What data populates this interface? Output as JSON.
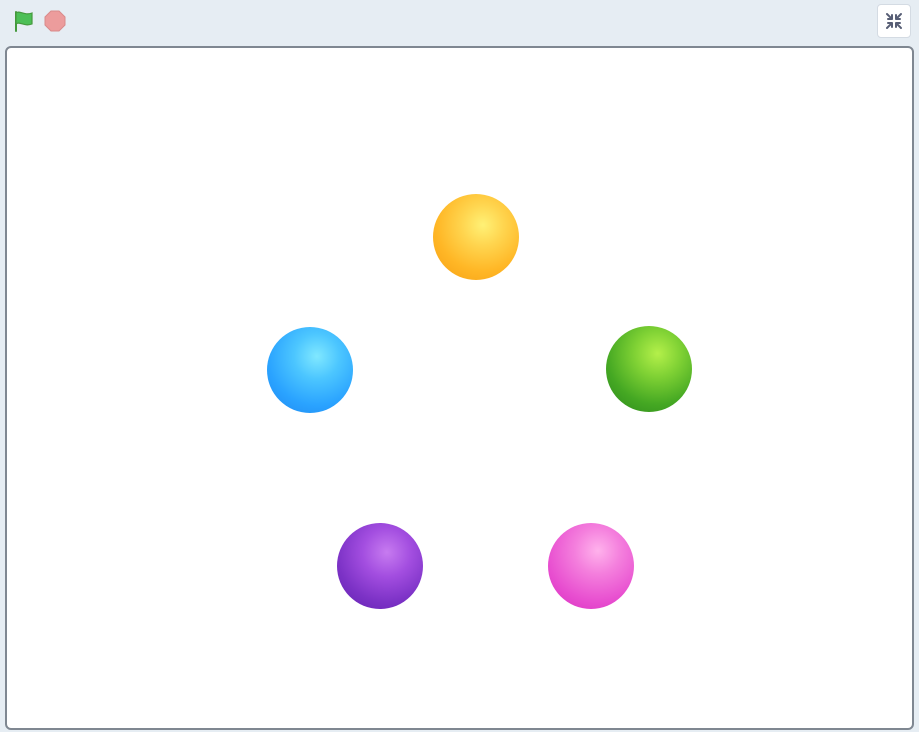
{
  "toolbar": {
    "green_flag_icon": "green-flag-icon",
    "stop_icon": "stop-icon",
    "unfullscreen_icon": "exit-fullscreen-icon"
  },
  "stage": {
    "sprites": [
      {
        "name": "orange-ball",
        "color": "#ffb726"
      },
      {
        "name": "blue-ball",
        "color": "#2aa3ff"
      },
      {
        "name": "green-ball",
        "color": "#45a823"
      },
      {
        "name": "purple-ball",
        "color": "#7c32c6"
      },
      {
        "name": "pink-ball",
        "color": "#e84fd0"
      }
    ]
  },
  "colors": {
    "toolbar_bg": "#e6edf3",
    "stage_border": "#7f8791",
    "flag_green": "#4cbf56",
    "stop_red": "#ec9c9c"
  }
}
